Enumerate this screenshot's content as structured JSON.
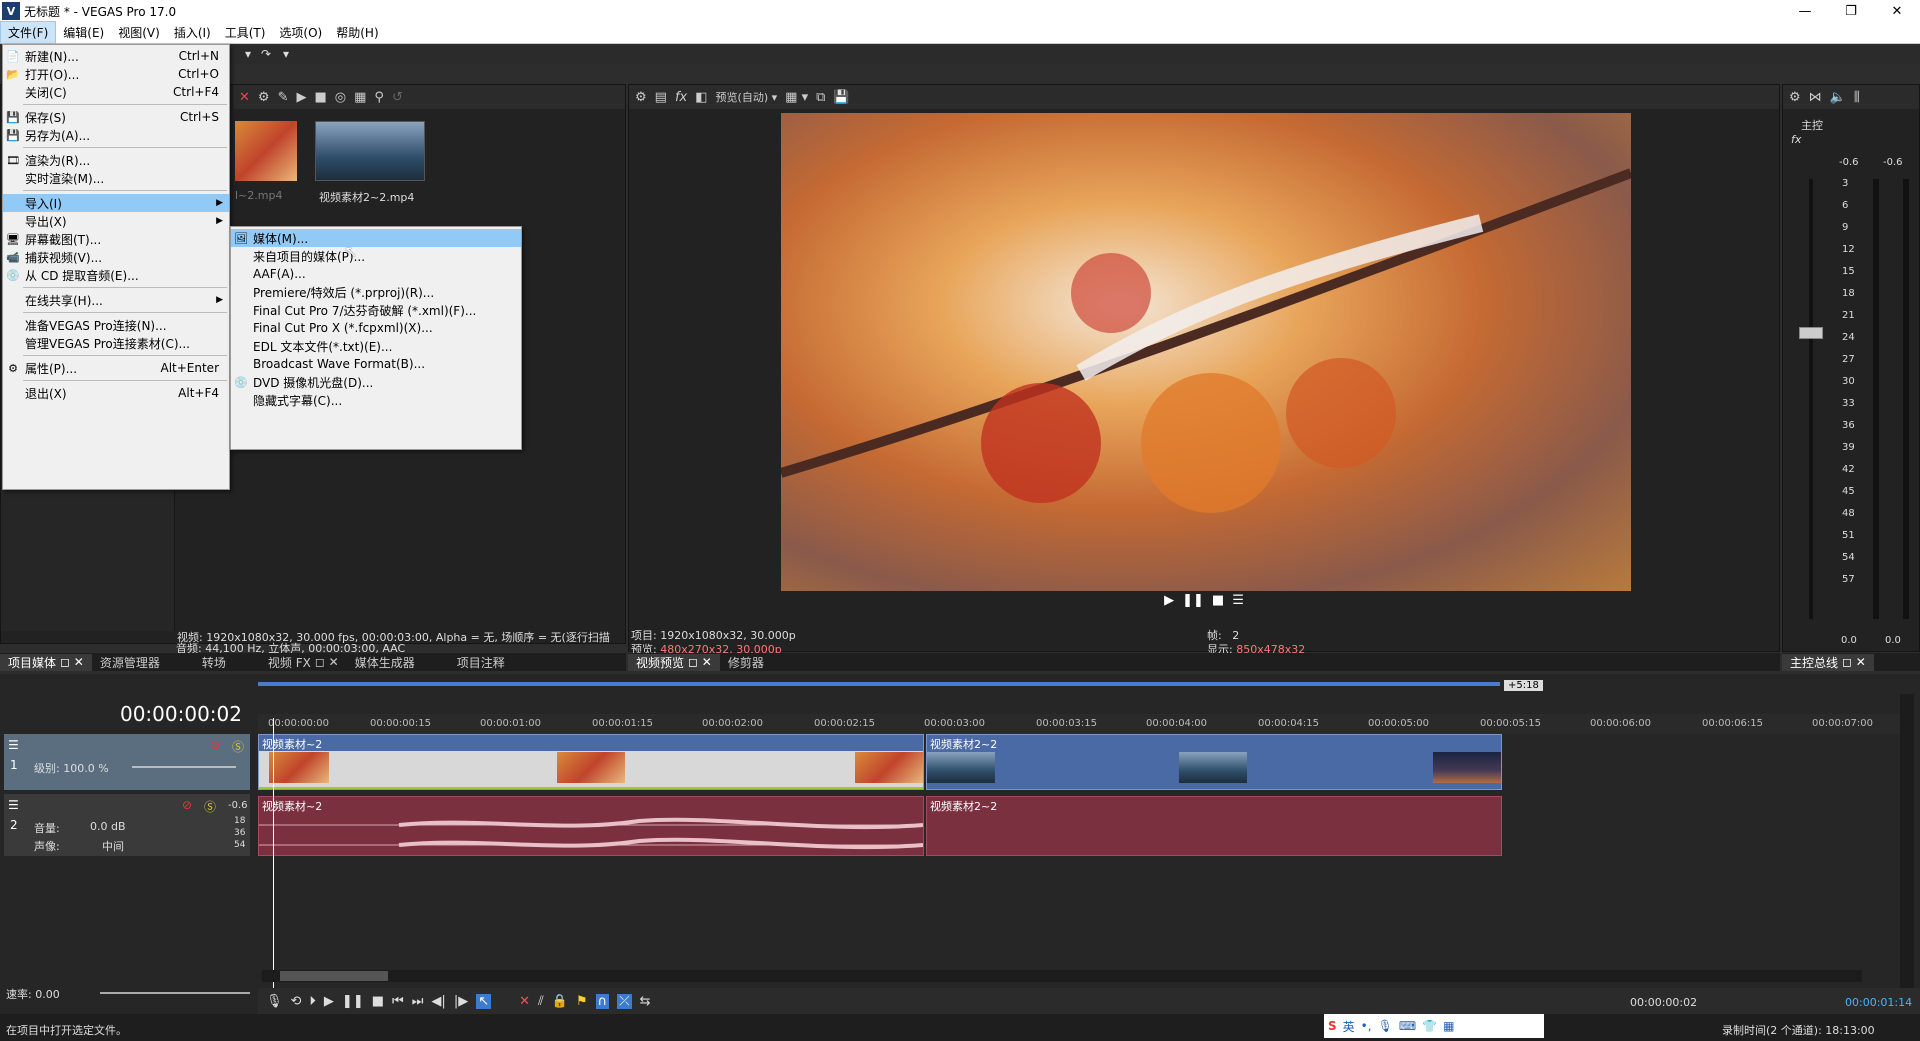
{
  "window": {
    "title": "无标题 * - VEGAS Pro 17.0",
    "app_icon": "V"
  },
  "menubar": [
    "文件(F)",
    "编辑(E)",
    "视图(V)",
    "插入(I)",
    "工具(T)",
    "选项(O)",
    "帮助(H)"
  ],
  "file_menu": [
    {
      "label": "新建(N)...",
      "shortcut": "Ctrl+N",
      "icon": "new-icon"
    },
    {
      "label": "打开(O)...",
      "shortcut": "Ctrl+O",
      "icon": "open-icon"
    },
    {
      "label": "关闭(C)",
      "shortcut": "Ctrl+F4"
    },
    {
      "label": "保存(S)",
      "shortcut": "Ctrl+S",
      "icon": "save-icon"
    },
    {
      "label": "另存为(A)...",
      "shortcut": "",
      "icon": "save-as-icon"
    },
    {
      "label": "渲染为(R)...",
      "shortcut": "",
      "icon": "render-icon"
    },
    {
      "label": "实时渲染(M)...",
      "shortcut": ""
    },
    {
      "label": "导入(I)",
      "shortcut": ""
    },
    {
      "label": "导出(X)",
      "shortcut": ""
    },
    {
      "label": "屏幕截图(T)...",
      "shortcut": "",
      "icon": "screenshot-icon"
    },
    {
      "label": "捕获视频(V)...",
      "shortcut": "",
      "icon": "capture-icon"
    },
    {
      "label": "从 CD 提取音频(E)...",
      "shortcut": "",
      "icon": "cd-icon"
    },
    {
      "label": "在线共享(H)...",
      "shortcut": ""
    },
    {
      "label": "准备VEGAS Pro连接(N)...",
      "shortcut": ""
    },
    {
      "label": "管理VEGAS Pro连接素材(C)...",
      "shortcut": ""
    },
    {
      "label": "属性(P)...",
      "shortcut": "Alt+Enter",
      "icon": "gear-icon"
    },
    {
      "label": "退出(X)",
      "shortcut": "Alt+F4"
    }
  ],
  "import_submenu": [
    "媒体(M)...",
    "来自项目的媒体(P)...",
    "AAF(A)...",
    "Premiere/特效后 (*.prproj)(R)...",
    "Final Cut Pro 7/达芬奇破解 (*.xml)(F)...",
    "Final Cut Pro X (*.fcpxml)(X)...",
    "EDL 文本文件(*.txt)(E)...",
    "Broadcast Wave Format(B)...",
    "DVD 摄像机光盘(D)...",
    "隐藏式字幕(C)..."
  ],
  "media": {
    "items": [
      "l~2.mp4",
      "视频素材2~2.mp4"
    ],
    "info_line1": "视频: 1920x1080x32, 30.000 fps, 00:00:03:00, Alpha = 无, 场顺序 = 无(逐行扫描",
    "info_line2": "音频: 44,100 Hz, 立体声, 00:00:03:00, AAC"
  },
  "left_tabs": [
    "项目媒体",
    "资源管理器",
    "转场",
    "视频 FX",
    "媒体生成器",
    "项目注释"
  ],
  "preview": {
    "quality": "预览(自动)",
    "project_label": "项目:",
    "project_value": "1920x1080x32, 30.000p",
    "preview_label": "预览:",
    "preview_value": "480x270x32, 30.000p",
    "frame_label": "帧:",
    "frame_value": "2",
    "display_label": "显示:",
    "display_value": "850x478x32"
  },
  "preview_tabs": [
    "视频预览",
    "修剪器"
  ],
  "master": {
    "label": "主控",
    "left_peak": "-0.6",
    "right_peak": "-0.6",
    "scale": [
      "3",
      "6",
      "9",
      "12",
      "15",
      "18",
      "21",
      "24",
      "27",
      "30",
      "33",
      "36",
      "39",
      "42",
      "45",
      "48",
      "51",
      "54",
      "57"
    ],
    "bottom_left": "0.0",
    "bottom_right": "0.0",
    "tab": "主控总线"
  },
  "timeline": {
    "timecode": "00:00:00:02",
    "end_marker": "+5:18",
    "ruler": [
      "00:00:00:00",
      "00:00:00:15",
      "00:00:01:00",
      "00:00:01:15",
      "00:00:02:00",
      "00:00:02:15",
      "00:00:03:00",
      "00:00:03:15",
      "00:00:04:00",
      "00:00:04:15",
      "00:00:05:00",
      "00:00:05:15",
      "00:00:06:00",
      "00:00:06:15",
      "00:00:07:00"
    ],
    "video_track": {
      "num": "1",
      "level_label": "级别: 100.0 %"
    },
    "audio_track": {
      "num": "2",
      "peak": "-0.6",
      "vol_label": "音量:",
      "vol_value": "0.0 dB",
      "pan_label": "声像:",
      "pan_value": "中间",
      "db_marks": [
        "18",
        "36",
        "54"
      ]
    },
    "clips": {
      "v1": "视频素材~2",
      "v2": "视频素材2~2",
      "a1": "视频素材~2",
      "a2": "视频素材2~2"
    },
    "rate": "速率: 0.00"
  },
  "status": {
    "left": "在项目中打开选定文件。",
    "timecode": "00:00:00:02",
    "record_time": "录制时间(2 个通道): 18:13:00",
    "ime_label": "英",
    "end_timecode": "00:00:01:14"
  }
}
